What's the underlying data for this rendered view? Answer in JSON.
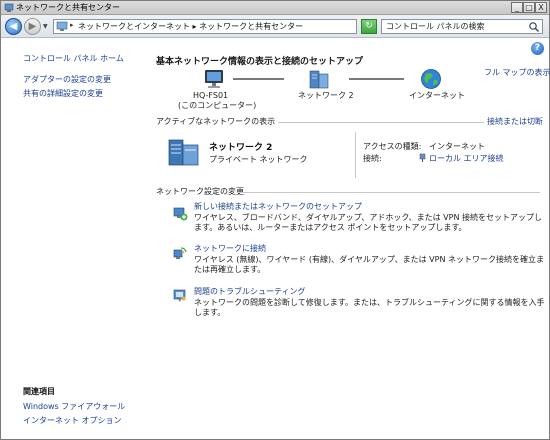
{
  "window": {
    "title": "ネットワークと共有センター",
    "controls": {
      "minimize": "_",
      "maximize": "□",
      "close": "X"
    }
  },
  "address_bar": {
    "path": "ネットワークとインターネット ▸ ネットワークと共有センター",
    "search_placeholder": "コントロール パネルの検索"
  },
  "sidebar": {
    "home": "コントロール パネル ホーム",
    "links": [
      "アダプターの設定の変更",
      "共有の詳細設定の変更"
    ],
    "related_heading": "関連項目",
    "related": [
      "Windows ファイアウォール",
      "インターネット オプション"
    ]
  },
  "main": {
    "title": "基本ネットワーク情報の表示と接続のセットアップ",
    "full_map": "フル マップの表示",
    "map": {
      "computer_name": "HQ-FS01",
      "computer_sub": "(このコンピューター)",
      "network": "ネットワーク 2",
      "internet": "インターネット"
    },
    "active": {
      "heading": "アクティブなネットワークの表示",
      "connect_link": "接続または切断",
      "network_name": "ネットワーク 2",
      "network_type": "プライベート ネットワーク",
      "access_label": "アクセスの種類:",
      "access_value": "インターネット",
      "conn_label": "接続:",
      "conn_value": "ローカル エリア接続"
    },
    "change": {
      "heading": "ネットワーク設定の変更",
      "tasks": [
        {
          "title": "新しい接続またはネットワークのセットアップ",
          "desc": "ワイヤレス、ブロードバンド、ダイヤルアップ、アドホック、または VPN 接続をセットアップします。あるいは、ルーターまたはアクセス ポイントをセットアップします。"
        },
        {
          "title": "ネットワークに接続",
          "desc": "ワイヤレス (無線)、ワイヤード (有線)、ダイヤルアップ、または VPN ネットワーク接続を確立または再確立します。"
        },
        {
          "title": "問題のトラブルシューティング",
          "desc": "ネットワークの問題を診断して修復します。または、トラブルシューティングに関する情報を入手します。"
        }
      ]
    }
  },
  "colors": {
    "link": "#1a3f8f",
    "rule": "#c7c7c7"
  }
}
